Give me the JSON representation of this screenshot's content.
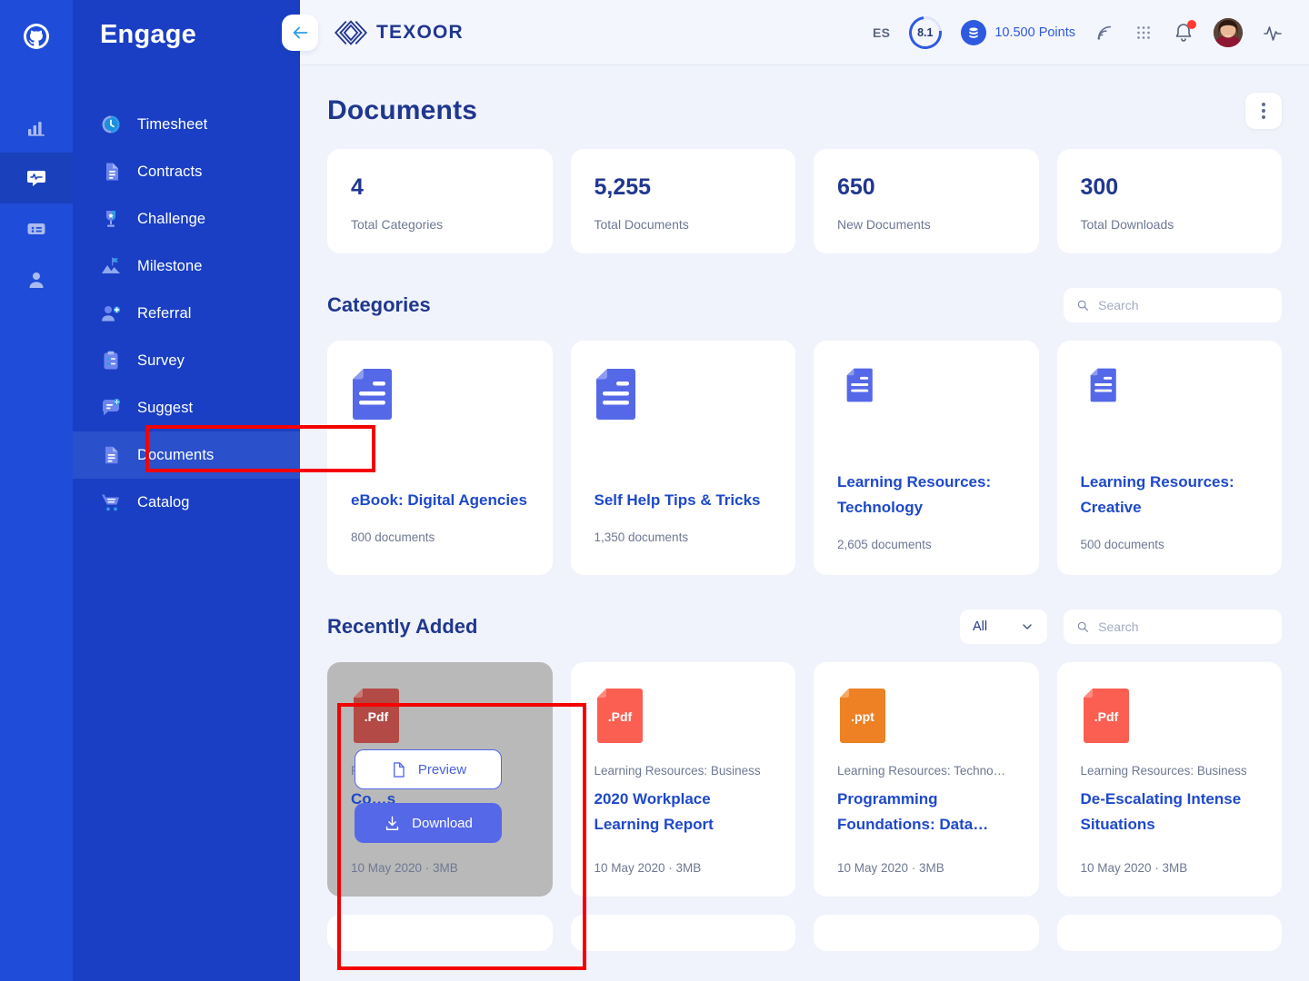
{
  "rail": {
    "logo_icon": "github-logo-icon",
    "items": [
      {
        "icon": "bar-chart-icon",
        "name": "analytics",
        "active": false
      },
      {
        "icon": "chat-pulse-icon",
        "name": "engage",
        "active": true
      },
      {
        "icon": "list-card-icon",
        "name": "boards",
        "active": false
      },
      {
        "icon": "user-icon",
        "name": "profile",
        "active": false
      }
    ]
  },
  "sidebar": {
    "brand": "Engage",
    "items": [
      {
        "label": "Timesheet",
        "icon": "clock-icon",
        "active": false
      },
      {
        "label": "Contracts",
        "icon": "document-icon",
        "active": false
      },
      {
        "label": "Challenge",
        "icon": "trophy-icon",
        "active": false
      },
      {
        "label": "Milestone",
        "icon": "mountain-flag-icon",
        "active": false
      },
      {
        "label": "Referral",
        "icon": "user-plus-icon",
        "active": false
      },
      {
        "label": "Survey",
        "icon": "clipboard-icon",
        "active": false
      },
      {
        "label": "Suggest",
        "icon": "chat-bulb-icon",
        "active": false
      },
      {
        "label": "Documents",
        "icon": "documents-icon",
        "active": true
      },
      {
        "label": "Catalog",
        "icon": "cart-icon",
        "active": false
      }
    ]
  },
  "topbar": {
    "back_icon": "arrow-left-icon",
    "logo_text": "TEXOOR",
    "language": "ES",
    "score": "8.1",
    "points_text": "10.500 Points",
    "icons": [
      "rss-icon",
      "apps-grid-icon",
      "bell-icon",
      "avatar",
      "activity-pulse-icon"
    ]
  },
  "page": {
    "title": "Documents",
    "stats": [
      {
        "value": "4",
        "label": "Total Categories"
      },
      {
        "value": "5,255",
        "label": "Total Documents"
      },
      {
        "value": "650",
        "label": "New Documents"
      },
      {
        "value": "300",
        "label": "Total Downloads"
      }
    ],
    "categories_section": {
      "title": "Categories",
      "search_placeholder": "Search",
      "search_value": "",
      "cards": [
        {
          "title": "eBook: Digital Agencies",
          "count": "800 documents"
        },
        {
          "title": "Self Help Tips & Tricks",
          "count": "1,350 documents"
        },
        {
          "title": "Learning Resources: Technology",
          "count": "2,605 documents"
        },
        {
          "title": "Learning Resources: Creative",
          "count": "500 documents"
        }
      ]
    },
    "recent_section": {
      "title": "Recently Added",
      "filter_value": "All",
      "search_placeholder": "Search",
      "search_value": "",
      "hover_actions": {
        "preview": "Preview",
        "download": "Download"
      },
      "cards": [
        {
          "file_type": ".Pdf",
          "file_color": "#b34a45",
          "category": "Pro…nts",
          "title": "Co…s",
          "meta": "10 May 2020  ·  3MB",
          "hovered": true
        },
        {
          "file_type": ".Pdf",
          "file_color": "#fb5f52",
          "category": "Learning Resources: Business",
          "title": "2020 Workplace Learning Report",
          "meta": "10 May 2020  ·  3MB",
          "hovered": false
        },
        {
          "file_type": ".ppt",
          "file_color": "#ed8124",
          "category": "Learning Resources: Techno…",
          "title": "Programming Foundations: Data…",
          "meta": "10 May 2020  ·  3MB",
          "hovered": false
        },
        {
          "file_type": ".Pdf",
          "file_color": "#fb5f52",
          "category": "Learning Resources: Business",
          "title": "De-Escalating Intense Situations",
          "meta": "10 May 2020  ·  3MB",
          "hovered": false
        }
      ]
    }
  },
  "colors": {
    "rail": "#1f4cd8",
    "sidebar": "#1a3fc4",
    "accent_blue": "#1e49c9",
    "button_blue": "#5468e8",
    "page_bg": "#f0f3fb",
    "title_navy": "#20378f",
    "highlight_red": "#f40000",
    "category_icon": "#5468e8"
  }
}
